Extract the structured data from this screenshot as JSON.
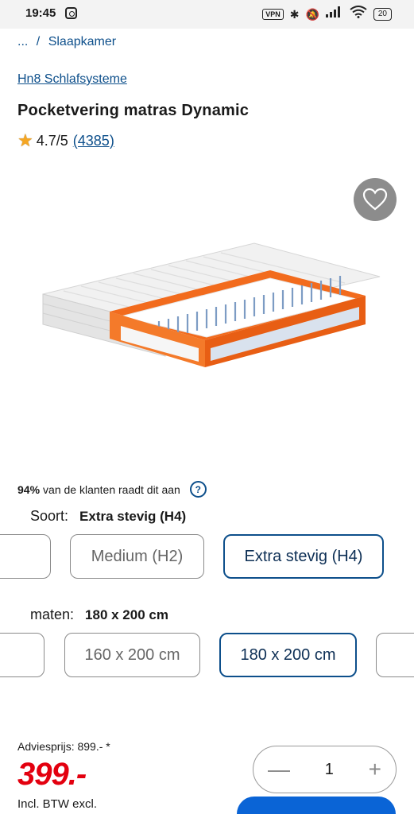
{
  "status_bar": {
    "time": "19:45",
    "icons": [
      "instagram-icon",
      "vpn-icon",
      "bluetooth-icon",
      "mute-icon",
      "signal-icon",
      "wifi-icon"
    ],
    "vpn_label": "VPN",
    "battery": "20"
  },
  "breadcrumb": {
    "ellipsis": "...",
    "separator": "/",
    "current": "Slaapkamer"
  },
  "product": {
    "brand": "Hn8 Schlafsysteme",
    "title": "Pocketvering matras Dynamic",
    "rating": "4.7/5",
    "review_count": "(4385)",
    "image_icon": "mattress-image"
  },
  "satisfaction": {
    "percent": "94%",
    "text": "van de klanten raadt dit aan",
    "help": "?"
  },
  "sort": {
    "label": "Soort:",
    "selected": "Extra stevig (H4)",
    "options": [
      "Medium (H2)",
      "Extra stevig (H4)"
    ]
  },
  "sizes": {
    "label": "maten:",
    "selected": "180 x 200 cm",
    "options": [
      "160 x 200 cm",
      "180 x 200 cm"
    ]
  },
  "pricing": {
    "advice_label": "Adviesprijs: 899.- *",
    "price": "399.-",
    "vat_note": "Incl. BTW excl.",
    "price_color": "#e3000f"
  },
  "quantity": {
    "value": "1",
    "minus": "—",
    "plus": "+"
  },
  "colors": {
    "accent": "#0d4f8b",
    "cart_button": "#0a64d6"
  }
}
